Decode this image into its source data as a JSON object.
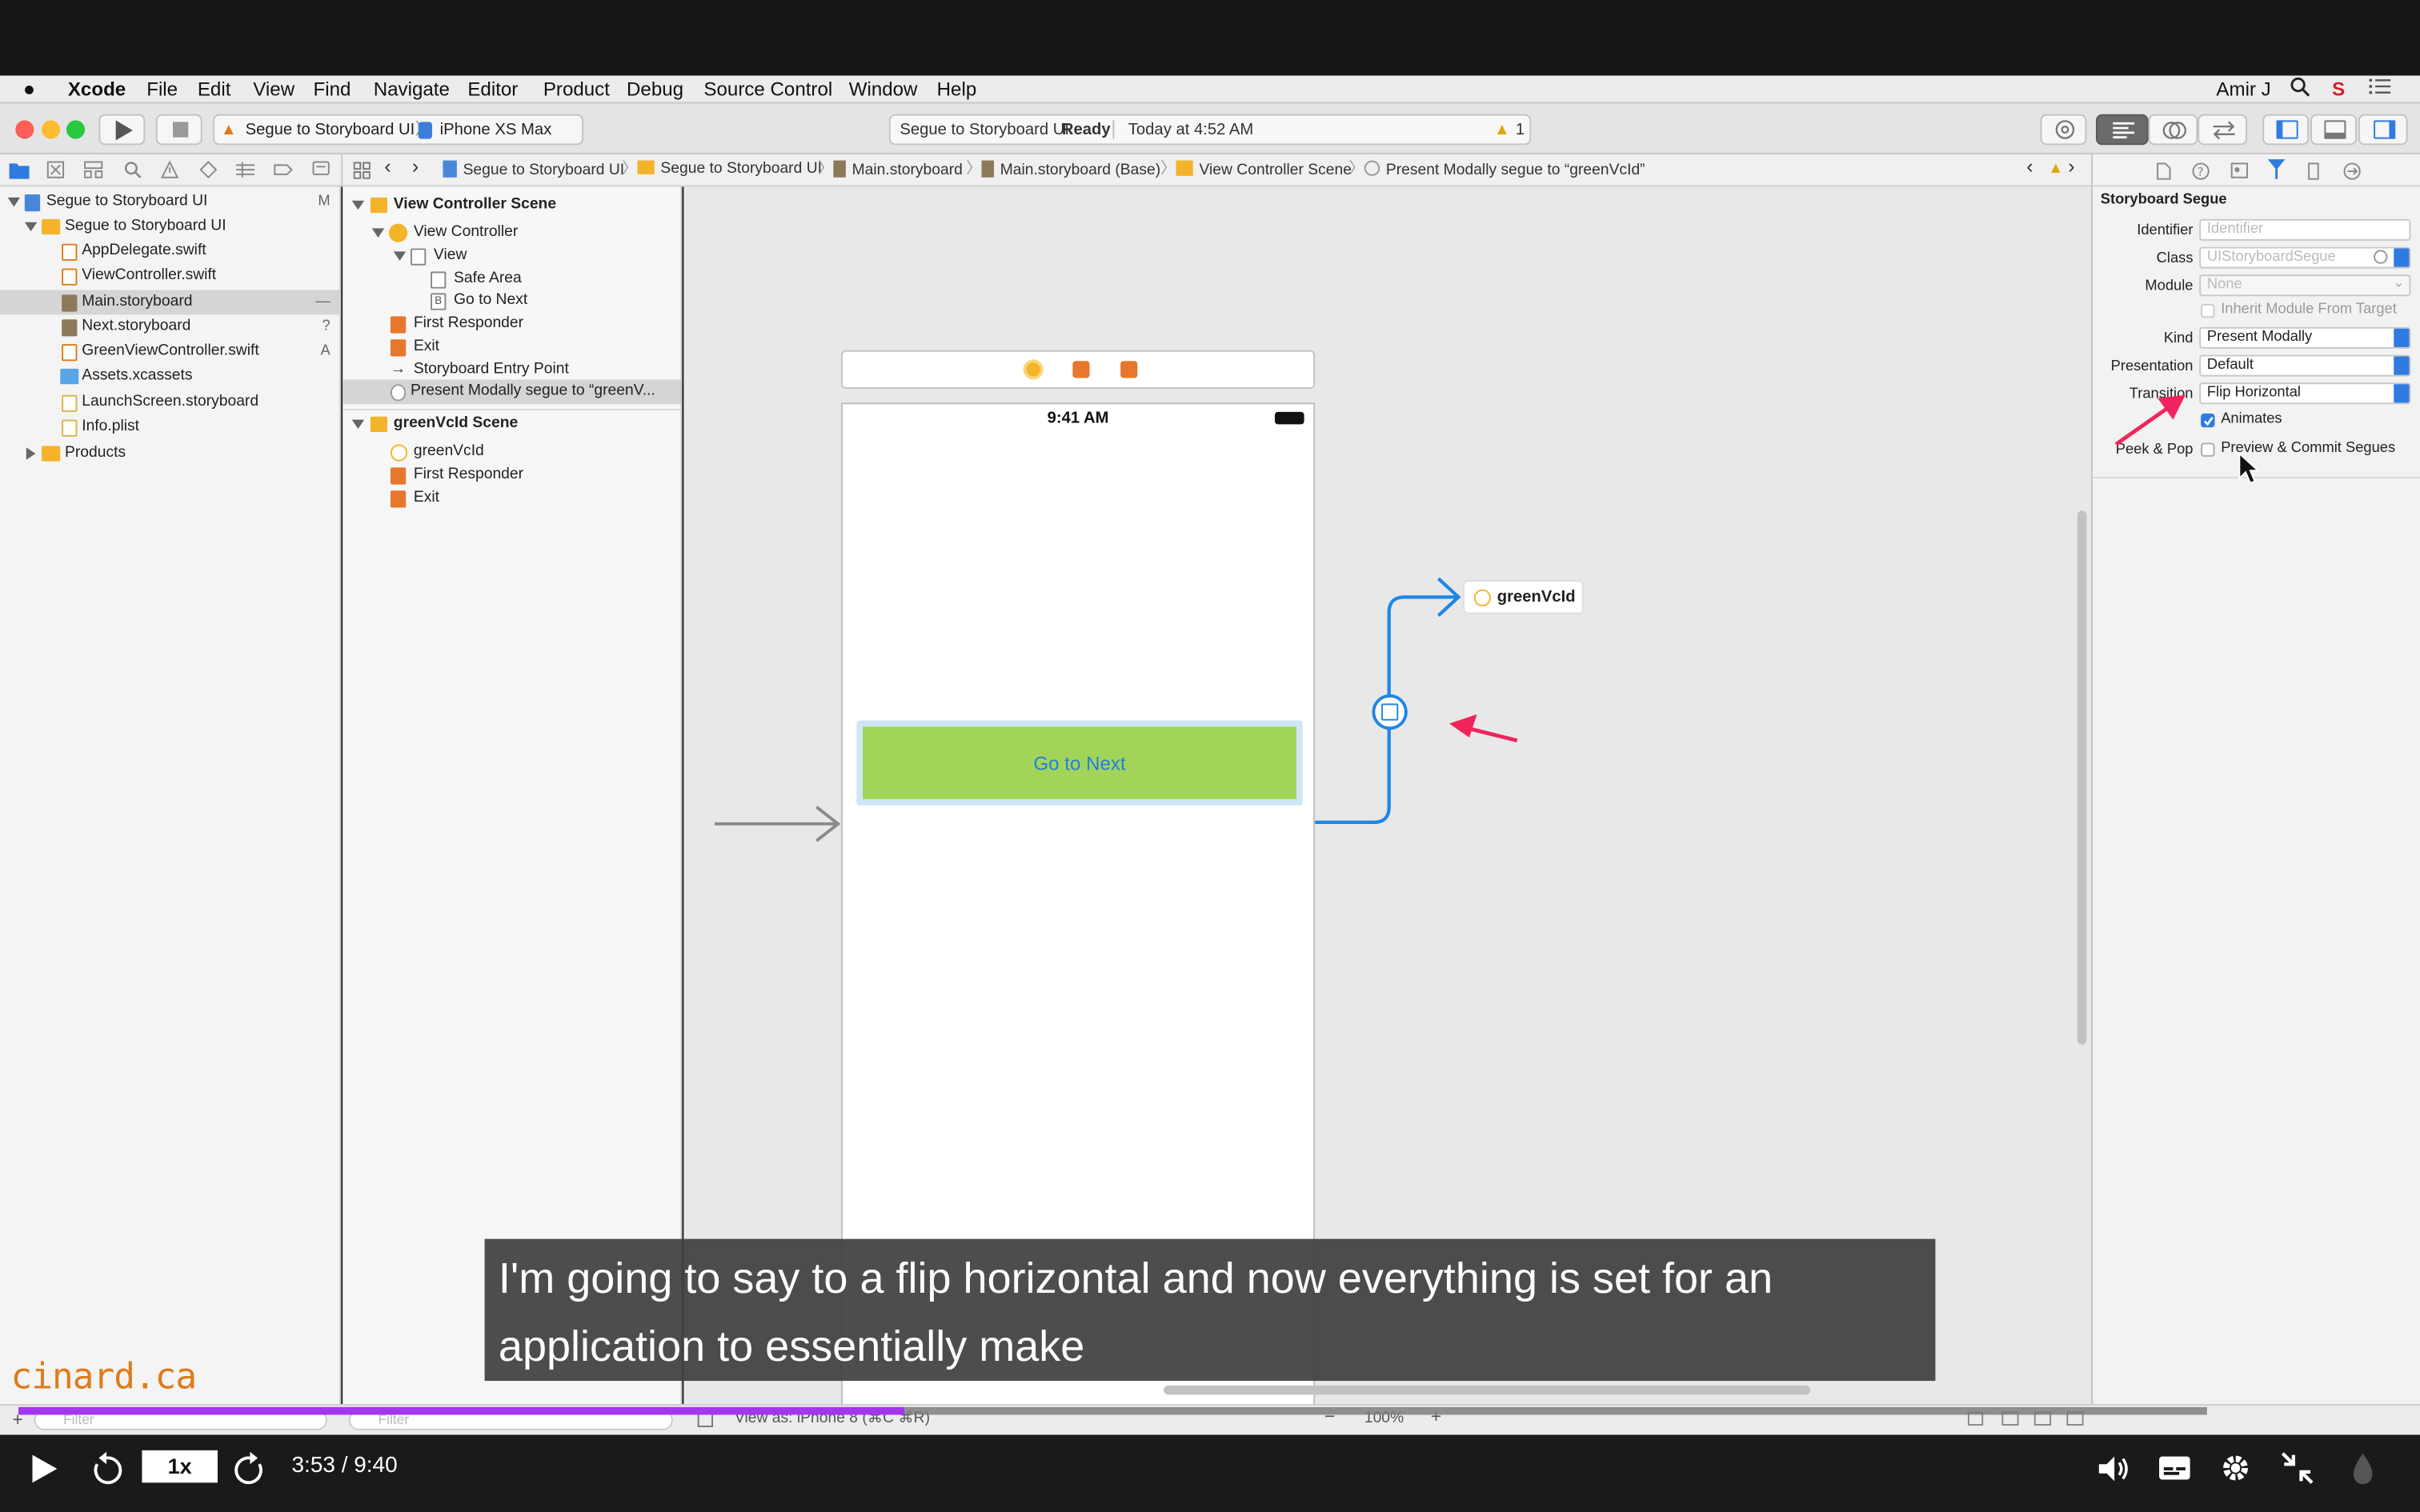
{
  "menubar": {
    "apple": "",
    "app": "Xcode",
    "items": [
      "File",
      "Edit",
      "View",
      "Find",
      "Navigate",
      "Editor",
      "Product",
      "Debug",
      "Source Control",
      "Window",
      "Help"
    ],
    "user": "Amir J"
  },
  "toolbar": {
    "scheme": "Segue to Storyboard UI",
    "device": "iPhone XS Max",
    "status_project": "Segue to Storyboard UI:",
    "status_state": "Ready",
    "status_time": "Today at 4:52 AM",
    "warning_count": "1"
  },
  "breadcrumb": [
    "Segue to Storyboard UI",
    "Segue to Storyboard UI",
    "Main.storyboard",
    "Main.storyboard (Base)",
    "View Controller Scene",
    "Present Modally segue to “greenVcId”"
  ],
  "navigator": {
    "items": [
      {
        "label": "Segue to Storyboard UI",
        "badge": "M"
      },
      {
        "label": "Segue to Storyboard UI",
        "badge": ""
      },
      {
        "label": "AppDelegate.swift",
        "badge": ""
      },
      {
        "label": "ViewController.swift",
        "badge": ""
      },
      {
        "label": "Main.storyboard",
        "badge": "—"
      },
      {
        "label": "Next.storyboard",
        "badge": "?"
      },
      {
        "label": "GreenViewController.swift",
        "badge": "A"
      },
      {
        "label": "Assets.xcassets",
        "badge": ""
      },
      {
        "label": "LaunchScreen.storyboard",
        "badge": ""
      },
      {
        "label": "Info.plist",
        "badge": ""
      },
      {
        "label": "Products",
        "badge": ""
      }
    ]
  },
  "outline": {
    "items": [
      "View Controller Scene",
      "View Controller",
      "View",
      "Safe Area",
      "Go to Next",
      "First Responder",
      "Exit",
      "Storyboard Entry Point",
      "Present Modally segue to “greenV...",
      "greenVcId Scene",
      "greenVcId",
      "First Responder",
      "Exit"
    ]
  },
  "canvas": {
    "status_time": "9:41 AM",
    "button_label": "Go to Next",
    "destination_label": "greenVcId"
  },
  "inspector": {
    "section_title": "Storyboard Segue",
    "identifier_label": "Identifier",
    "identifier_placeholder": "Identifier",
    "class_label": "Class",
    "class_placeholder": "UIStoryboardSegue",
    "module_label": "Module",
    "module_placeholder": "None",
    "inherit_label": "Inherit Module From Target",
    "kind_label": "Kind",
    "kind_value": "Present Modally",
    "presentation_label": "Presentation",
    "presentation_value": "Default",
    "transition_label": "Transition",
    "transition_value": "Flip Horizontal",
    "animates_label": "Animates",
    "peek_label": "Peek & Pop",
    "peek_value": "Preview & Commit Segues"
  },
  "bottombar": {
    "filter_placeholder": "Filter",
    "view_as": "View as: iPhone 8 (⌘C ⌘R)",
    "zoom": "100%"
  },
  "overlay": {
    "watermark": "cinard.ca",
    "caption": "I'm going to say to a flip horizontal and now everything is set for an application to essentially make"
  },
  "player": {
    "speed": "1x",
    "time": "3:53 / 9:40",
    "progress": 0.405
  },
  "colors": {
    "accent": "#2f7be0",
    "button_green": "#a3d45a",
    "segue_blue": "#1e86e6",
    "annotation_red": "#f0245c",
    "progress_purple": "#a435f0"
  }
}
